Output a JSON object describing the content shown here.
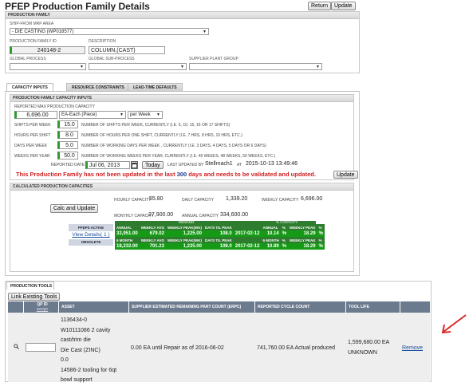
{
  "header": {
    "title": "PFEP Production Family Details",
    "return_label": "Return",
    "update_label": "Update"
  },
  "family": {
    "section_title": "PRODUCTION FAMILY",
    "ship_from_label": "SHIP-FROM MRP AREA",
    "ship_from_value": "- DIE CASTING (WP018577)",
    "family_id_label": "PRODUCTION FAMILY ID",
    "family_id_value": "240148-2",
    "description_label": "DESCRIPTION",
    "description_value": "COLUMN,(CAST)",
    "global_process_label": "GLOBAL PROCESS",
    "global_subprocess_label": "GLOBAL SUB-PROCESS",
    "supplier_plant_group_label": "SUPPLIER PLANT GROUP"
  },
  "tabs": [
    {
      "label": "CAPACITY INPUTS",
      "active": true
    },
    {
      "label": "RESOURCE CONSTRAINTS",
      "active": false
    },
    {
      "label": "LEAD-TIME DEFAULTS",
      "active": false
    }
  ],
  "capacity_inputs": {
    "section_title": "PRODUCTION FAMILY CAPACITY INPUTS",
    "reported_max_label": "REPORTED MAX PRODUCTION CAPACITY",
    "capacity_value": "6,696.00",
    "uom_value": "EA-Each (Piece)",
    "period_value": "per Week",
    "shifts_label": "SHIFTS PER WEEK",
    "shifts_value": "15.0",
    "shifts_help": "NUMBER OF SHIFTS PER WEEK, CURRENTLY (I.E. 5, 10, 15, 16 OR 17 SHIFTS)",
    "hours_label": "HOURS PER SHIFT",
    "hours_value": "8.0",
    "hours_help": "NUMBER OF HOURS PER ONE SHIFT, CURRENTLY (I.E. 7 HRS, 8 HRS, 10 HRS, ETC.)",
    "days_label": "DAYS PER WEEK",
    "days_value": "5.0",
    "days_help": "NUMBER OF WORKING DAYS PER WEEK , CURRENTLY (I.E. 3 DAYS, 4 DAYS, 5 DAYS OR 6 DAYS)",
    "weeks_label": "WEEKS PER YEAR",
    "weeks_value": "50.0",
    "weeks_help": "NUMBER OF WORKING WEEKS PER YEAR, CURRENTLY (I.E. 46 WEEKS, 48 WEEKS, 50 WEEKS, ETC.)",
    "reported_date_label": "REPORTED DATE",
    "reported_date_value": "Jul 06, 2013",
    "today_label": "Today",
    "last_updated_label": "LAST UPDATED BY",
    "last_updated_user": "Stellmach1",
    "at_label": "AT",
    "last_updated_time": "2015-10-13 13:49:46",
    "warning_pre": "This Production Family has not been updated in the last ",
    "warning_days": "300",
    "warning_post": " days and needs to be validated and updated.",
    "update_label": "Update"
  },
  "calculated": {
    "section_title": "CALCULATED PRODUCTION CAPACITIES",
    "calc_button": "Calc and Update",
    "hourly_label": "HOURLY CAPACITY",
    "hourly_value": "55.80",
    "daily_label": "DAILY CAPACITY",
    "daily_value": "1,339.20",
    "weekly_label": "WEEKLY CAPACITY",
    "weekly_value": "6,696.00",
    "monthly_label": "MONTHLY CAPACITY",
    "monthly_value": "27,900.00",
    "annual_label": "ANNUAL CAPACITY",
    "annual_value": "334,600.00",
    "pfeps_active_label": "PFEPS ACTIVE",
    "view_details_label": "View Details( 1 )",
    "obsolete_label": "OBSOLETE",
    "demand_label": "DEMAND",
    "pct_capacity_label": "% CAPACITY",
    "head1": [
      "ANNUAL",
      "WEEKLY AVG",
      "WEEKLY PEAK(WK)",
      "DAYS TIL PEAK",
      "",
      "ANNUAL",
      "%",
      "WEEKLY PEAK",
      "%"
    ],
    "row1": [
      "33,951.00",
      "679.02",
      "1,225.00",
      "108.0",
      "2017-02-12",
      "10.14",
      "%",
      "18.29",
      "%"
    ],
    "head2": [
      "6 MONTH",
      "WEEKLY AVG",
      "WEEKLY PEAK(WK)",
      "DAYS TIL PEAK",
      "",
      "6 MONTH",
      "%",
      "WEEKLY PEAK",
      "%"
    ],
    "row2": [
      "18,232.00",
      "701.23",
      "1,225.00",
      "108.0",
      "2017-02-12",
      "10.89",
      "%",
      "18.29",
      "%"
    ]
  },
  "tools": {
    "section_title": "PRODUCTION TOOLS",
    "link_button": "Link Existing Tools",
    "col_qr": "QP ID",
    "col_qr_sub": "assign",
    "col_asset": "ASSET",
    "col_erpc": "SUPPLIER ESTIMATED REMAINING PART COUNT (ERPC)",
    "col_cycle": "REPORTED CYCLE COUNT",
    "col_life": "TOOL LIFE",
    "row": {
      "asset_lines": [
        "1136434-0",
        "W10111086 2 cavity",
        "cast/trim die",
        "Die Cast (ZINC)",
        "0.0",
        "14586-2 tooling for 6qt",
        "bowl support"
      ],
      "erpc": "0.00 EA  until Repair as of 2016-06-02",
      "cycle": "741,760.00 EA Actual produced",
      "life_1": "1,599,680.00 EA",
      "life_2": "UNKNOWN",
      "remove_label": "Remove"
    }
  },
  "colors": {
    "green": "#159a15",
    "red": "#d02020",
    "arrow": "#d82a2a",
    "header_gray": "#6c7a8e"
  }
}
